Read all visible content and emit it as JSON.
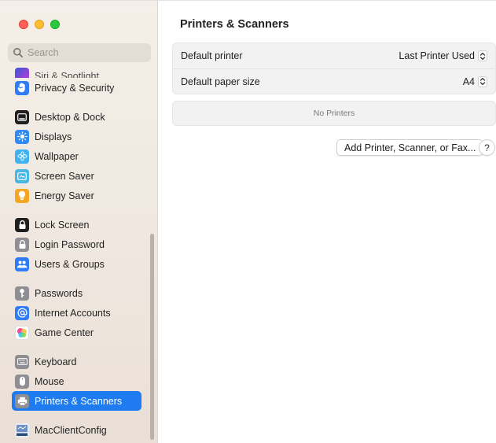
{
  "window": {
    "controls": [
      "close",
      "minimize",
      "zoom"
    ]
  },
  "search": {
    "placeholder": "Search",
    "icon": "magnifying-glass-icon"
  },
  "sidebar": {
    "partial_item": {
      "label": "Siri & Spotlight",
      "icon": "siri-icon"
    },
    "groups": [
      [
        {
          "label": "Privacy & Security",
          "icon": "hand-icon",
          "color": "#2f7cf6"
        }
      ],
      [
        {
          "label": "Desktop & Dock",
          "icon": "dock-icon",
          "color": "#1f1f1f"
        },
        {
          "label": "Displays",
          "icon": "sun-icon",
          "color": "#2f8cf6"
        },
        {
          "label": "Wallpaper",
          "icon": "flower-icon",
          "color": "#3fb2f0"
        },
        {
          "label": "Screen Saver",
          "icon": "screen-saver-icon",
          "color": "#47b7e6"
        },
        {
          "label": "Energy Saver",
          "icon": "lightbulb-icon",
          "color": "#f5a623"
        }
      ],
      [
        {
          "label": "Lock Screen",
          "icon": "lock-icon",
          "color": "#1f1f1f"
        },
        {
          "label": "Login Password",
          "icon": "lock-icon",
          "color": "#8e8e93"
        },
        {
          "label": "Users & Groups",
          "icon": "users-icon",
          "color": "#2f7cf6"
        }
      ],
      [
        {
          "label": "Passwords",
          "icon": "key-icon",
          "color": "#8e8e93"
        },
        {
          "label": "Internet Accounts",
          "icon": "at-icon",
          "color": "#2f7cf6"
        },
        {
          "label": "Game Center",
          "icon": "game-center-icon",
          "color": "#ffffff"
        }
      ],
      [
        {
          "label": "Keyboard",
          "icon": "keyboard-icon",
          "color": "#8e8e93"
        },
        {
          "label": "Mouse",
          "icon": "mouse-icon",
          "color": "#8e8e93"
        },
        {
          "label": "Printers & Scanners",
          "icon": "printer-icon",
          "color": "#8e8e93",
          "selected": true
        }
      ],
      [
        {
          "label": "MacClientConfig",
          "icon": "mac-client-config-icon",
          "color": "#4a6fa5"
        }
      ]
    ],
    "selected_color": "#1e7cf0"
  },
  "main": {
    "title": "Printers & Scanners",
    "settings": [
      {
        "label": "Default printer",
        "value": "Last Printer Used"
      },
      {
        "label": "Default paper size",
        "value": "A4"
      }
    ],
    "empty_state": "No Printers",
    "add_button": "Add Printer, Scanner, or Fax...",
    "help_button": "?"
  }
}
